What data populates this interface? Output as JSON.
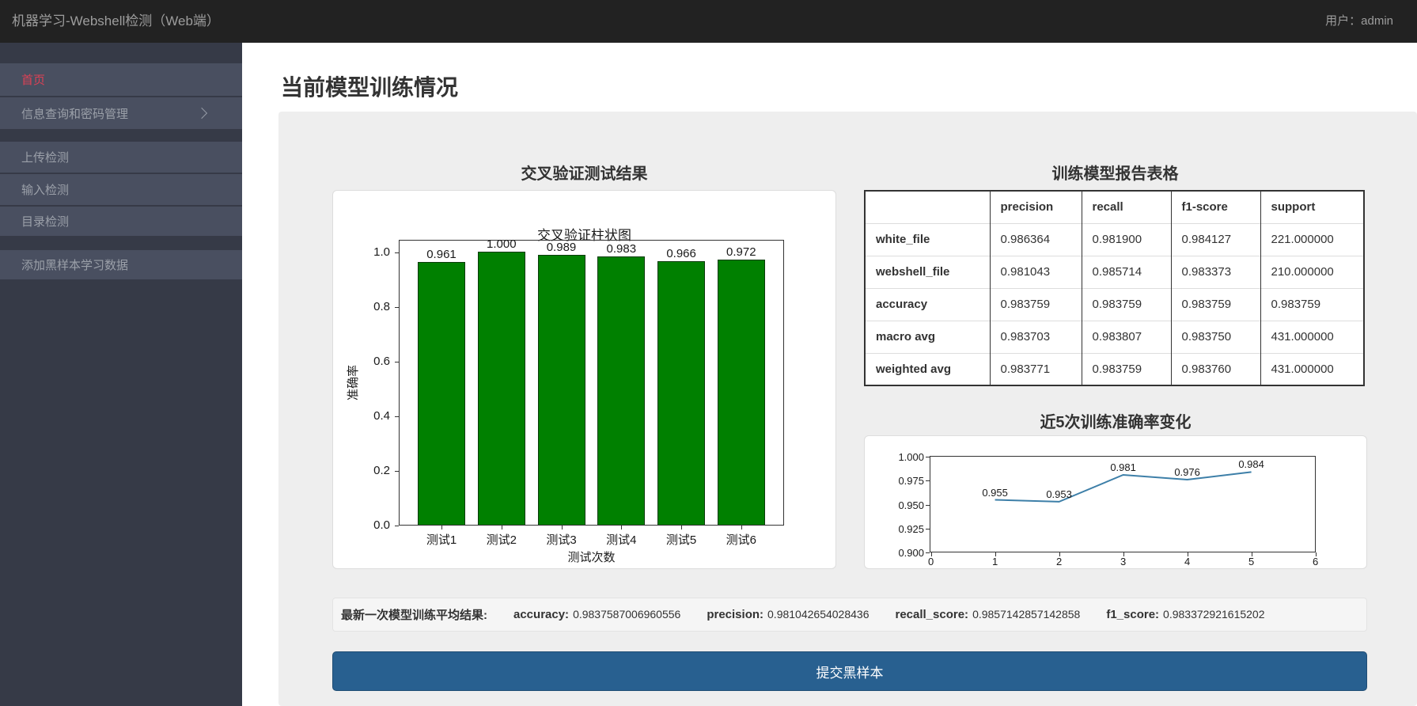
{
  "topbar": {
    "title": "机器学习-Webshell检测（Web端）",
    "user_label": "用户：admin"
  },
  "sidebar": {
    "items": [
      {
        "label": "首页",
        "active": true,
        "chevron": false
      },
      {
        "label": "信息查询和密码管理",
        "active": false,
        "chevron": true
      },
      {
        "label": "上传检测",
        "active": false,
        "chevron": false
      },
      {
        "label": "输入检测",
        "active": false,
        "chevron": false
      },
      {
        "label": "目录检测",
        "active": false,
        "chevron": false
      },
      {
        "label": "添加黑样本学习数据",
        "active": false,
        "chevron": false
      }
    ]
  },
  "page_title": "当前模型训练情况",
  "bar_section": {
    "title": "交叉验证测试结果"
  },
  "table_section": {
    "title": "训练模型报告表格",
    "columns": [
      "precision",
      "recall",
      "f1-score",
      "support"
    ],
    "rows": [
      {
        "label": "white_file",
        "values": [
          "0.986364",
          "0.981900",
          "0.984127",
          "221.000000"
        ]
      },
      {
        "label": "webshell_file",
        "values": [
          "0.981043",
          "0.985714",
          "0.983373",
          "210.000000"
        ]
      },
      {
        "label": "accuracy",
        "values": [
          "0.983759",
          "0.983759",
          "0.983759",
          "0.983759"
        ]
      },
      {
        "label": "macro avg",
        "values": [
          "0.983703",
          "0.983807",
          "0.983750",
          "431.000000"
        ]
      },
      {
        "label": "weighted avg",
        "values": [
          "0.983771",
          "0.983759",
          "0.983760",
          "431.000000"
        ]
      }
    ]
  },
  "line_section": {
    "title": "近5次训练准确率变化"
  },
  "chart_data": [
    {
      "type": "bar",
      "title": "交叉验证柱状图",
      "xlabel": "测试次数",
      "ylabel": "准确率",
      "categories": [
        "测试1",
        "测试2",
        "测试3",
        "测试4",
        "测试5",
        "测试6"
      ],
      "values": [
        0.961,
        1.0,
        0.989,
        0.983,
        0.966,
        0.972
      ],
      "value_labels": [
        "0.961",
        "1.000",
        "0.989",
        "0.983",
        "0.966",
        "0.972"
      ],
      "ylim": [
        0,
        1.045
      ],
      "yticks": [
        1.0,
        0.8,
        0.6,
        0.4,
        0.2,
        0.0
      ],
      "ytick_labels": [
        "1.0",
        "0.8",
        "0.6",
        "0.4",
        "0.2",
        "0.0"
      ],
      "bar_color": "#008000"
    },
    {
      "type": "line",
      "x": [
        1,
        2,
        3,
        4,
        5
      ],
      "values": [
        0.955,
        0.953,
        0.981,
        0.976,
        0.984
      ],
      "value_labels": [
        "0.955",
        "0.953",
        "0.981",
        "0.976",
        "0.984"
      ],
      "xlim": [
        0,
        6
      ],
      "ylim": [
        0.9,
        1.0
      ],
      "yticks": [
        1.0,
        0.975,
        0.95,
        0.925,
        0.9
      ],
      "ytick_labels": [
        "1.000",
        "0.975",
        "0.950",
        "0.925",
        "0.900"
      ],
      "xticks": [
        0,
        1,
        2,
        3,
        4,
        5,
        6
      ],
      "line_color": "#3d7fa8"
    }
  ],
  "summary": {
    "prefix": "最新一次模型训练平均结果:",
    "metrics": [
      {
        "label": "accuracy:",
        "value": "0.9837587006960556"
      },
      {
        "label": "precision:",
        "value": "0.981042654028436"
      },
      {
        "label": "recall_score:",
        "value": "0.9857142857142858"
      },
      {
        "label": "f1_score:",
        "value": "0.983372921615202"
      }
    ]
  },
  "submit_button": "提交黑样本",
  "colors": {
    "accent_red": "#dc4155",
    "button_bg": "#286090",
    "bar_green": "#008000",
    "line_blue": "#3d7fa8",
    "topbar_bg": "#222222",
    "sidebar_bg": "#363a47",
    "nav_item_bg": "#494f60"
  }
}
